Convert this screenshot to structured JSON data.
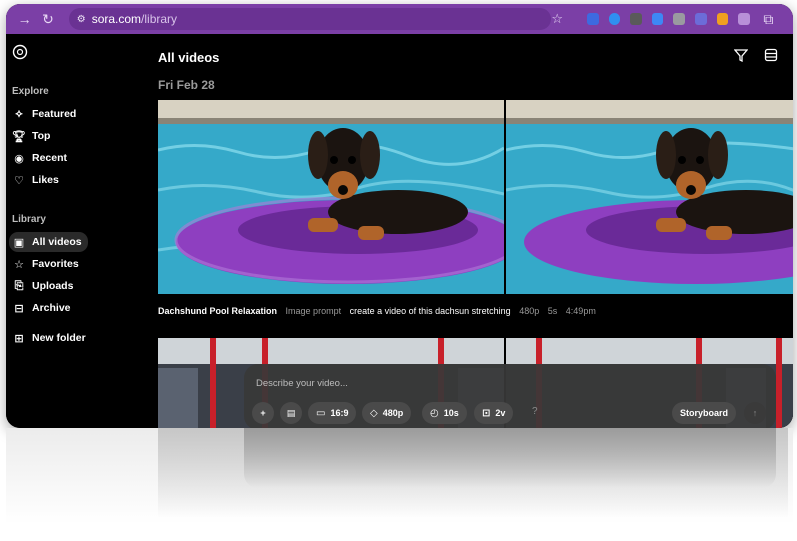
{
  "browser": {
    "url_host": "sora.com",
    "url_path": "/library",
    "ext_colors": [
      "#3d6ae0",
      "#2f8ff0",
      "#5a5a5a",
      "#3d88f5",
      "#9a9aa0",
      "#6c6cd8",
      "#f0a020",
      "#b890d8"
    ]
  },
  "sidebar": {
    "explore_title": "Explore",
    "library_title": "Library",
    "explore_items": [
      {
        "label": "Featured",
        "icon": "featured-icon"
      },
      {
        "label": "Top",
        "icon": "trophy-icon"
      },
      {
        "label": "Recent",
        "icon": "recent-icon"
      },
      {
        "label": "Likes",
        "icon": "heart-icon"
      }
    ],
    "library_items": [
      {
        "label": "All videos",
        "icon": "video-icon",
        "active": true
      },
      {
        "label": "Favorites",
        "icon": "star-icon"
      },
      {
        "label": "Uploads",
        "icon": "upload-icon"
      },
      {
        "label": "Archive",
        "icon": "archive-icon"
      }
    ],
    "new_folder": "New folder"
  },
  "main": {
    "title": "All videos",
    "date": "Fri Feb 28",
    "video": {
      "title": "Dachshund Pool Relaxation",
      "type": "Image prompt",
      "prompt": "create a video of this dachsun stretching",
      "resolution": "480p",
      "duration": "5s",
      "time": "4:49pm"
    }
  },
  "composer": {
    "placeholder": "Describe your video...",
    "aspect": "16:9",
    "resolution": "480p",
    "duration": "10s",
    "variations": "2v",
    "help": "?",
    "storyboard": "Storyboard"
  }
}
